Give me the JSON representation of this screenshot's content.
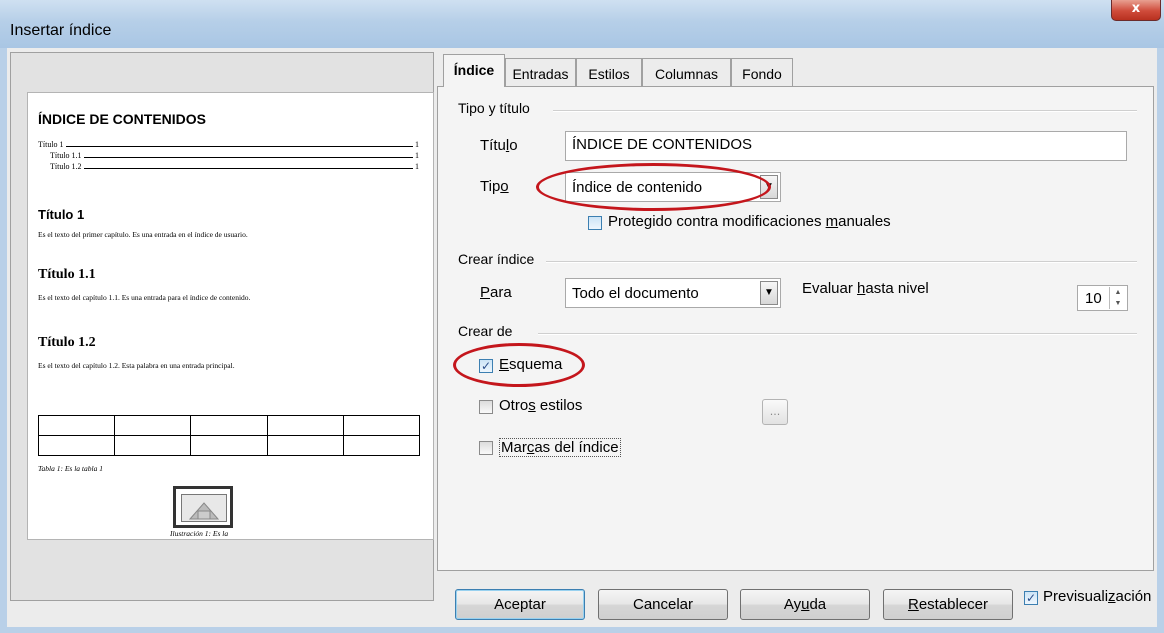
{
  "window": {
    "title": "Insertar índice",
    "close_label": "x"
  },
  "preview": {
    "toc_title": "ÍNDICE DE CONTENIDOS",
    "toc_rows": [
      {
        "label": "Título 1",
        "page": "1"
      },
      {
        "label": "Título 1.1",
        "page": "1"
      },
      {
        "label": "Título 1.2",
        "page": "1"
      }
    ],
    "h1": "Título 1",
    "p1": "Es el texto del primer capítulo. Es una entrada en el índice de usuario.",
    "h2a": "Título 1.1",
    "p2": "Es el texto del capítulo 1.1. Es una entrada para el índice de contenido.",
    "h2b": "Título 1.2",
    "p3": "Es el texto del capítulo 1.2. Esta palabra en una entrada principal.",
    "table_caption": "Tabla 1: Es la tabla 1",
    "figure_caption": "Ilustración 1: Es la"
  },
  "tabs": [
    "Índice",
    "Entradas",
    "Estilos",
    "Columnas",
    "Fondo"
  ],
  "tipo_titulo": {
    "section": "Tipo y título",
    "titulo_label": "Título",
    "titulo_value": "ÍNDICE DE CONTENIDOS",
    "tipo_label": "Tipo",
    "tipo_value": "Índice de contenido",
    "protegido_label": "Protegido contra modificaciones manuales"
  },
  "crear_indice": {
    "section": "Crear índice",
    "para_label": "Para",
    "para_value": "Todo el documento",
    "evaluar_label": "Evaluar hasta nivel",
    "nivel_value": "10"
  },
  "crear_de": {
    "section": "Crear de",
    "esquema_label": "Esquema",
    "esquema_checked": true,
    "otros_label": "Otros estilos",
    "otros_checked": false,
    "otros_button": "...",
    "marcas_label": "Marcas del índice",
    "marcas_checked": false
  },
  "buttons": {
    "aceptar": "Aceptar",
    "cancelar": "Cancelar",
    "ayuda": "Ayuda",
    "restablecer": "Restablecer"
  },
  "previsualizacion": {
    "label": "Previsualización",
    "checked": true
  },
  "colors": {
    "annotation_oval": "#c4161c",
    "title_bar": "#b6cfe8"
  }
}
